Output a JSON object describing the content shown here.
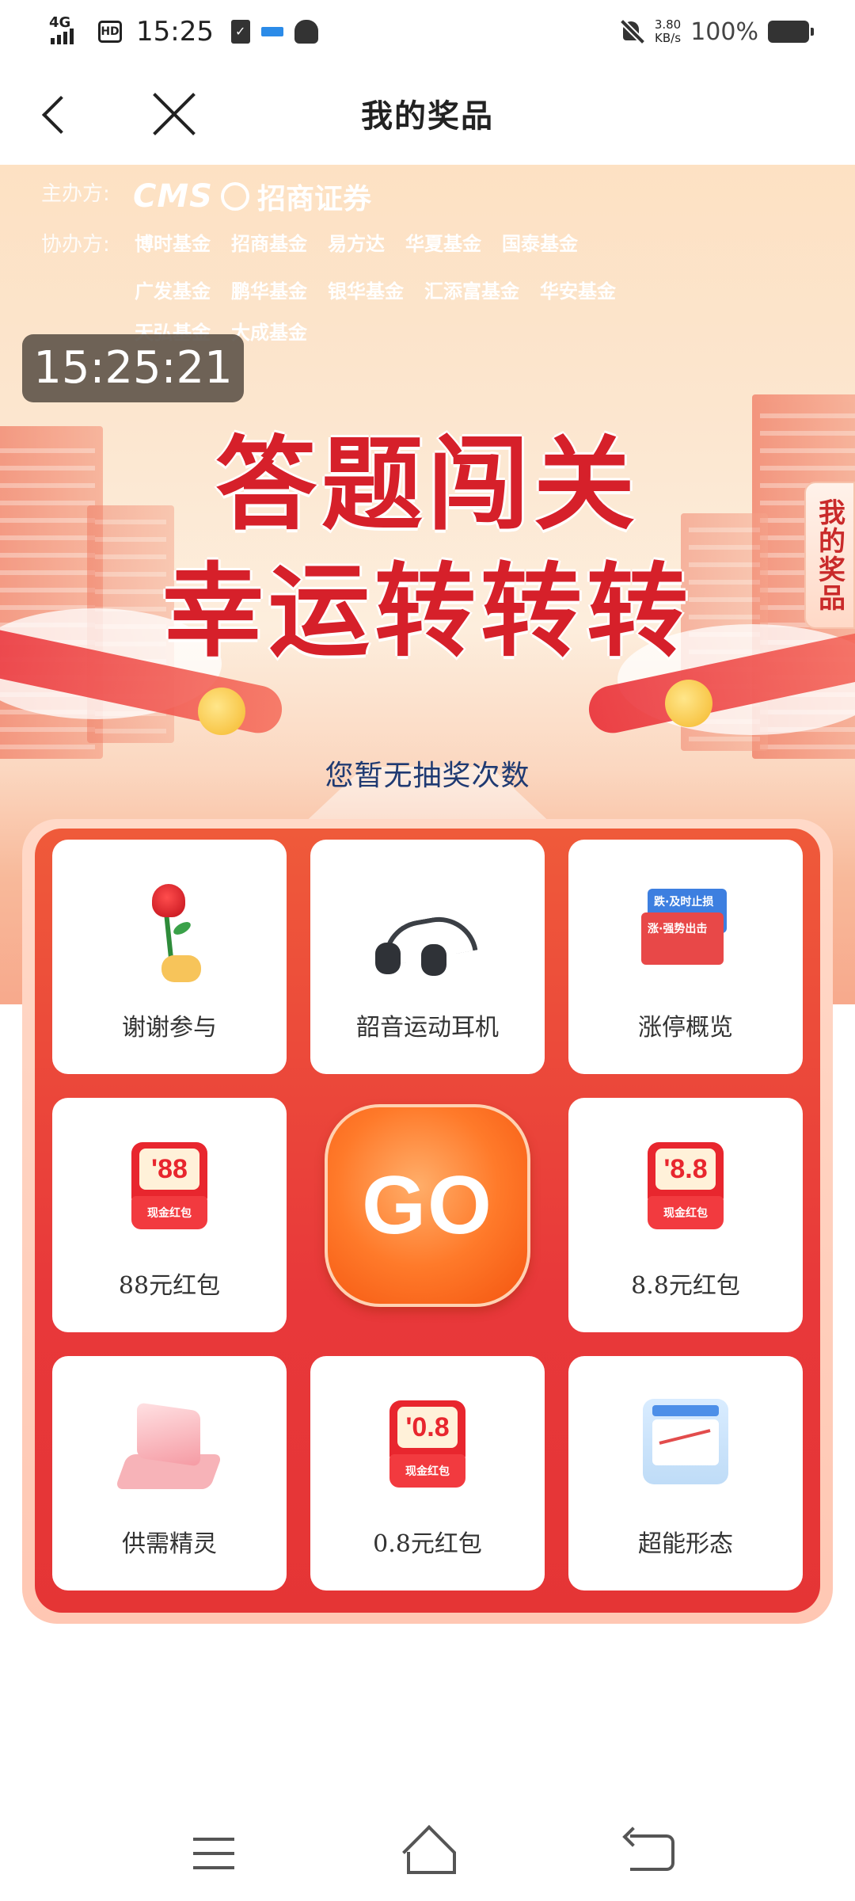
{
  "status_bar": {
    "network": "4G",
    "hd": "HD",
    "time": "15:25",
    "speed_value": "3.80",
    "speed_unit": "KB/s",
    "battery": "100%"
  },
  "nav": {
    "title": "我的奖品"
  },
  "banner": {
    "host_label": "主办方:",
    "cohost_label": "协办方:",
    "host_brand": "CMS",
    "host_name": "招商证券",
    "cohosts_row1": [
      "博时基金",
      "招商基金",
      "易方达",
      "华夏基金",
      "国泰基金"
    ],
    "cohosts_row2": [
      "广发基金",
      "鹏华基金",
      "银华基金",
      "汇添富基金",
      "华安基金"
    ],
    "cohosts_row3": [
      "天弘基金",
      "大成基金"
    ],
    "timer": "15:25:21",
    "headline_line1": "答题闯关",
    "headline_line2": "幸运转转转",
    "side_tab": "我的奖品",
    "chance_text": "您暂无抽奖次数"
  },
  "prizes": [
    {
      "label": "谢谢参与",
      "icon": "rose-icon"
    },
    {
      "label": "韶音运动耳机",
      "icon": "headphones-icon"
    },
    {
      "label": "涨停概览",
      "icon": "market-cards-icon",
      "card_top": "跌·及时止损",
      "card_bottom": "涨·强势出击"
    },
    {
      "label": "88元红包",
      "icon": "red-envelope-icon",
      "amount": "'88",
      "caption": "现金红包"
    },
    {
      "label": "8.8元红包",
      "icon": "red-envelope-icon",
      "amount": "'8.8",
      "caption": "现金红包"
    },
    {
      "label": "供需精灵",
      "icon": "supply-demand-icon"
    },
    {
      "label": "0.8元红包",
      "icon": "red-envelope-icon",
      "amount": "'0.8",
      "caption": "现金红包"
    },
    {
      "label": "超能形态",
      "icon": "chart-pattern-icon"
    }
  ],
  "go_button": "GO",
  "colors": {
    "headline": "#d6202a",
    "board": "#e8383a",
    "go": "#ff7a2a",
    "chance_text": "#1f3a72"
  }
}
